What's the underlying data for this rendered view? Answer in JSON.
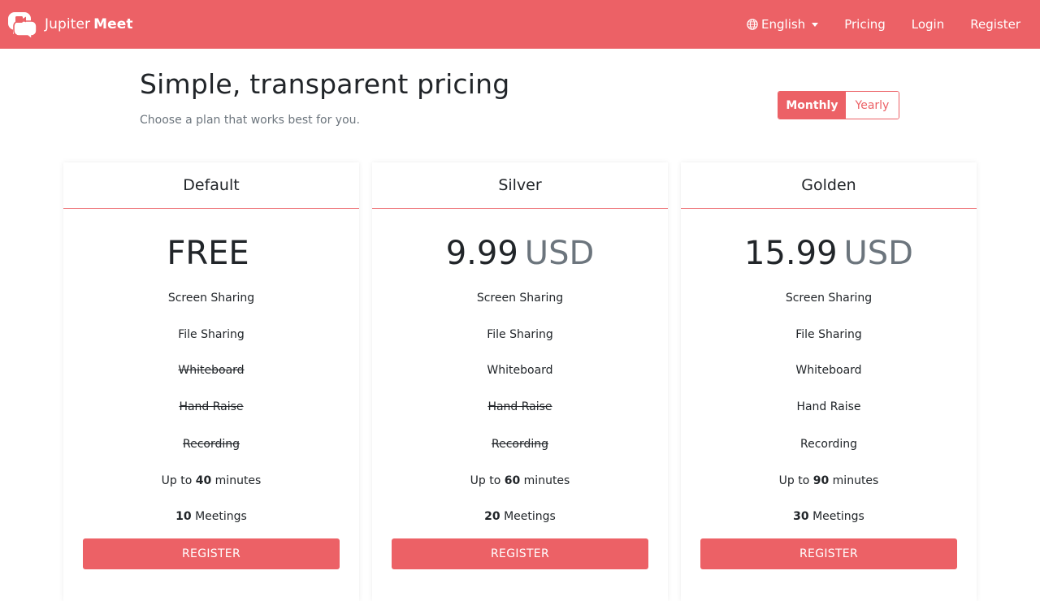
{
  "brand": {
    "name_part1": "Jupiter",
    "name_part2": "Meet",
    "icon": "chat-video-logo-icon",
    "color": "#ec6166"
  },
  "nav": {
    "language": "English",
    "language_icon": "globe-icon",
    "pricing": "Pricing",
    "login": "Login",
    "register": "Register"
  },
  "hero": {
    "title": "Simple, transparent pricing",
    "subtitle": "Choose a plan that works best for you."
  },
  "billing_toggle": {
    "monthly": "Monthly",
    "yearly": "Yearly",
    "selected": "Monthly"
  },
  "plans": [
    {
      "name": "Default",
      "price": "FREE",
      "currency": "",
      "features": [
        {
          "label": "Screen Sharing",
          "included": true
        },
        {
          "label": "File Sharing",
          "included": true
        },
        {
          "label": "Whiteboard",
          "included": false
        },
        {
          "label": "Hand Raise",
          "included": false
        },
        {
          "label": "Recording",
          "included": false
        }
      ],
      "minutes_prefix": "Up to",
      "minutes": "40",
      "minutes_suffix": "minutes",
      "meetings": "10",
      "meetings_suffix": "Meetings",
      "button": "REGISTER"
    },
    {
      "name": "Silver",
      "price": "9.99",
      "currency": "USD",
      "features": [
        {
          "label": "Screen Sharing",
          "included": true
        },
        {
          "label": "File Sharing",
          "included": true
        },
        {
          "label": "Whiteboard",
          "included": true
        },
        {
          "label": "Hand Raise",
          "included": false
        },
        {
          "label": "Recording",
          "included": false
        }
      ],
      "minutes_prefix": "Up to",
      "minutes": "60",
      "minutes_suffix": "minutes",
      "meetings": "20",
      "meetings_suffix": "Meetings",
      "button": "REGISTER"
    },
    {
      "name": "Golden",
      "price": "15.99",
      "currency": "USD",
      "features": [
        {
          "label": "Screen Sharing",
          "included": true
        },
        {
          "label": "File Sharing",
          "included": true
        },
        {
          "label": "Whiteboard",
          "included": true
        },
        {
          "label": "Hand Raise",
          "included": true
        },
        {
          "label": "Recording",
          "included": true
        }
      ],
      "minutes_prefix": "Up to",
      "minutes": "90",
      "minutes_suffix": "minutes",
      "meetings": "30",
      "meetings_suffix": "Meetings",
      "button": "REGISTER"
    }
  ]
}
